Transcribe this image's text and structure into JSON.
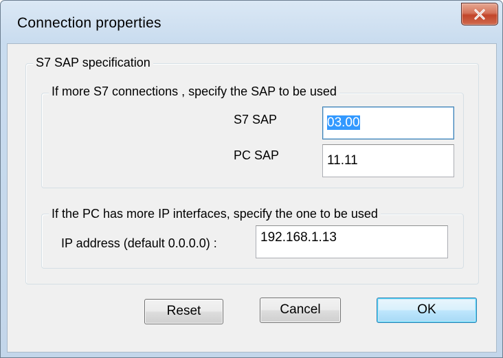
{
  "window": {
    "title": "Connection properties",
    "close_icon": "close-icon"
  },
  "sap_group": {
    "legend": "S7 SAP specification",
    "connections_group": {
      "legend": "If more S7 connections , specify the SAP to be used",
      "s7_sap_label": "S7 SAP",
      "s7_sap_value": "03.00",
      "pc_sap_label": "PC SAP",
      "pc_sap_value": "11.11"
    },
    "ip_group": {
      "legend": "If the PC has more IP interfaces, specify the one to be used",
      "ip_label": "IP address (default 0.0.0.0) :",
      "ip_value": "192.168.1.13"
    }
  },
  "buttons": {
    "reset": "Reset",
    "cancel": "Cancel",
    "ok": "OK"
  },
  "colors": {
    "title_bar": "#c9dcef",
    "close_button": "#c2452a",
    "selection": "#3399ff",
    "default_button_border": "#3c7fb1"
  }
}
